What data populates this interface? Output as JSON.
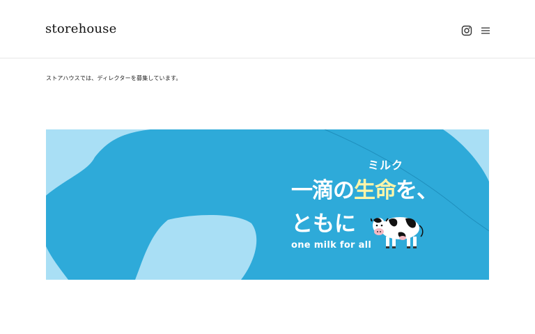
{
  "site": {
    "logo": "storehouse"
  },
  "header": {
    "icons": {
      "instagram": "instagram-icon",
      "menu": "hamburger-menu-icon"
    }
  },
  "main": {
    "intro": "ストアハウスでは、ディレクターを募集しています。",
    "banner": {
      "ruby": "ミルク",
      "line1_before": "一滴の",
      "line1_highlight": "生命",
      "line1_after": "を、",
      "line2": "ともに",
      "tagline": "one milk for all"
    }
  },
  "colors": {
    "banner_bg": "#2eaad9",
    "banner_light": "#a9dff5",
    "highlight": "#fff5a8"
  }
}
